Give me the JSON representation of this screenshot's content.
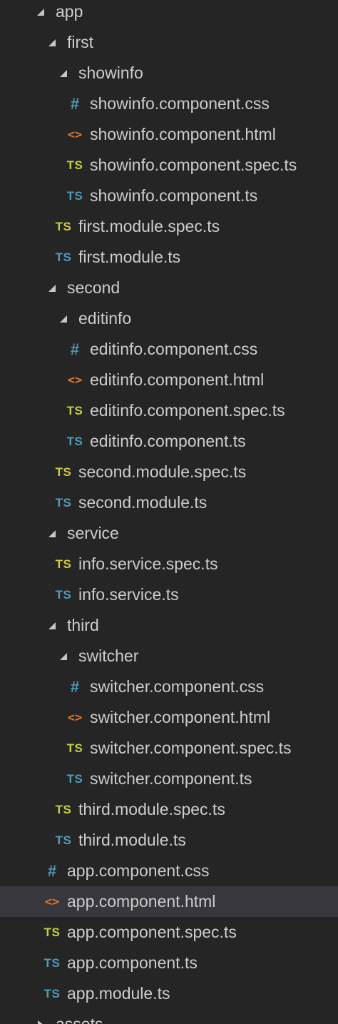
{
  "colors": {
    "background": "#252526",
    "selected_row": "#37373d",
    "text": "#cccccc",
    "twisty": "#c5c5c5",
    "ts_spec": "#cbcb41",
    "ts": "#519aba",
    "css": "#519aba",
    "html": "#e37933"
  },
  "icon_glyphs": {
    "ts": "TS",
    "css": "#",
    "html": "<>"
  },
  "tree": [
    {
      "label": "app",
      "depth": 0,
      "kind": "folder",
      "expanded": true,
      "icon": "chevron-down-icon"
    },
    {
      "label": "first",
      "depth": 1,
      "kind": "folder",
      "expanded": true,
      "icon": "chevron-down-icon"
    },
    {
      "label": "showinfo",
      "depth": 2,
      "kind": "folder",
      "expanded": true,
      "icon": "chevron-down-icon"
    },
    {
      "label": "showinfo.component.css",
      "depth": 3,
      "kind": "css",
      "icon": "css-file-icon"
    },
    {
      "label": "showinfo.component.html",
      "depth": 3,
      "kind": "html",
      "icon": "html-file-icon"
    },
    {
      "label": "showinfo.component.spec.ts",
      "depth": 3,
      "kind": "ts-spec",
      "icon": "typescript-spec-file-icon"
    },
    {
      "label": "showinfo.component.ts",
      "depth": 3,
      "kind": "ts",
      "icon": "typescript-file-icon"
    },
    {
      "label": "first.module.spec.ts",
      "depth": 2,
      "kind": "ts-spec",
      "icon": "typescript-spec-file-icon"
    },
    {
      "label": "first.module.ts",
      "depth": 2,
      "kind": "ts",
      "icon": "typescript-file-icon"
    },
    {
      "label": "second",
      "depth": 1,
      "kind": "folder",
      "expanded": true,
      "icon": "chevron-down-icon"
    },
    {
      "label": "editinfo",
      "depth": 2,
      "kind": "folder",
      "expanded": true,
      "icon": "chevron-down-icon"
    },
    {
      "label": "editinfo.component.css",
      "depth": 3,
      "kind": "css",
      "icon": "css-file-icon"
    },
    {
      "label": "editinfo.component.html",
      "depth": 3,
      "kind": "html",
      "icon": "html-file-icon"
    },
    {
      "label": "editinfo.component.spec.ts",
      "depth": 3,
      "kind": "ts-spec",
      "icon": "typescript-spec-file-icon"
    },
    {
      "label": "editinfo.component.ts",
      "depth": 3,
      "kind": "ts",
      "icon": "typescript-file-icon"
    },
    {
      "label": "second.module.spec.ts",
      "depth": 2,
      "kind": "ts-spec",
      "icon": "typescript-spec-file-icon"
    },
    {
      "label": "second.module.ts",
      "depth": 2,
      "kind": "ts",
      "icon": "typescript-file-icon"
    },
    {
      "label": "service",
      "depth": 1,
      "kind": "folder",
      "expanded": true,
      "icon": "chevron-down-icon"
    },
    {
      "label": "info.service.spec.ts",
      "depth": 2,
      "kind": "ts-spec",
      "icon": "typescript-spec-file-icon"
    },
    {
      "label": "info.service.ts",
      "depth": 2,
      "kind": "ts",
      "icon": "typescript-file-icon"
    },
    {
      "label": "third",
      "depth": 1,
      "kind": "folder",
      "expanded": true,
      "icon": "chevron-down-icon"
    },
    {
      "label": "switcher",
      "depth": 2,
      "kind": "folder",
      "expanded": true,
      "icon": "chevron-down-icon"
    },
    {
      "label": "switcher.component.css",
      "depth": 3,
      "kind": "css",
      "icon": "css-file-icon"
    },
    {
      "label": "switcher.component.html",
      "depth": 3,
      "kind": "html",
      "icon": "html-file-icon"
    },
    {
      "label": "switcher.component.spec.ts",
      "depth": 3,
      "kind": "ts-spec",
      "icon": "typescript-spec-file-icon"
    },
    {
      "label": "switcher.component.ts",
      "depth": 3,
      "kind": "ts",
      "icon": "typescript-file-icon"
    },
    {
      "label": "third.module.spec.ts",
      "depth": 2,
      "kind": "ts-spec",
      "icon": "typescript-spec-file-icon"
    },
    {
      "label": "third.module.ts",
      "depth": 2,
      "kind": "ts",
      "icon": "typescript-file-icon"
    },
    {
      "label": "app.component.css",
      "depth": 1,
      "kind": "css",
      "icon": "css-file-icon"
    },
    {
      "label": "app.component.html",
      "depth": 1,
      "kind": "html",
      "icon": "html-file-icon",
      "selected": true
    },
    {
      "label": "app.component.spec.ts",
      "depth": 1,
      "kind": "ts-spec",
      "icon": "typescript-spec-file-icon"
    },
    {
      "label": "app.component.ts",
      "depth": 1,
      "kind": "ts",
      "icon": "typescript-file-icon"
    },
    {
      "label": "app.module.ts",
      "depth": 1,
      "kind": "ts",
      "icon": "typescript-file-icon"
    },
    {
      "label": "assets",
      "depth": 0,
      "kind": "folder",
      "expanded": false,
      "icon": "chevron-right-icon"
    }
  ]
}
